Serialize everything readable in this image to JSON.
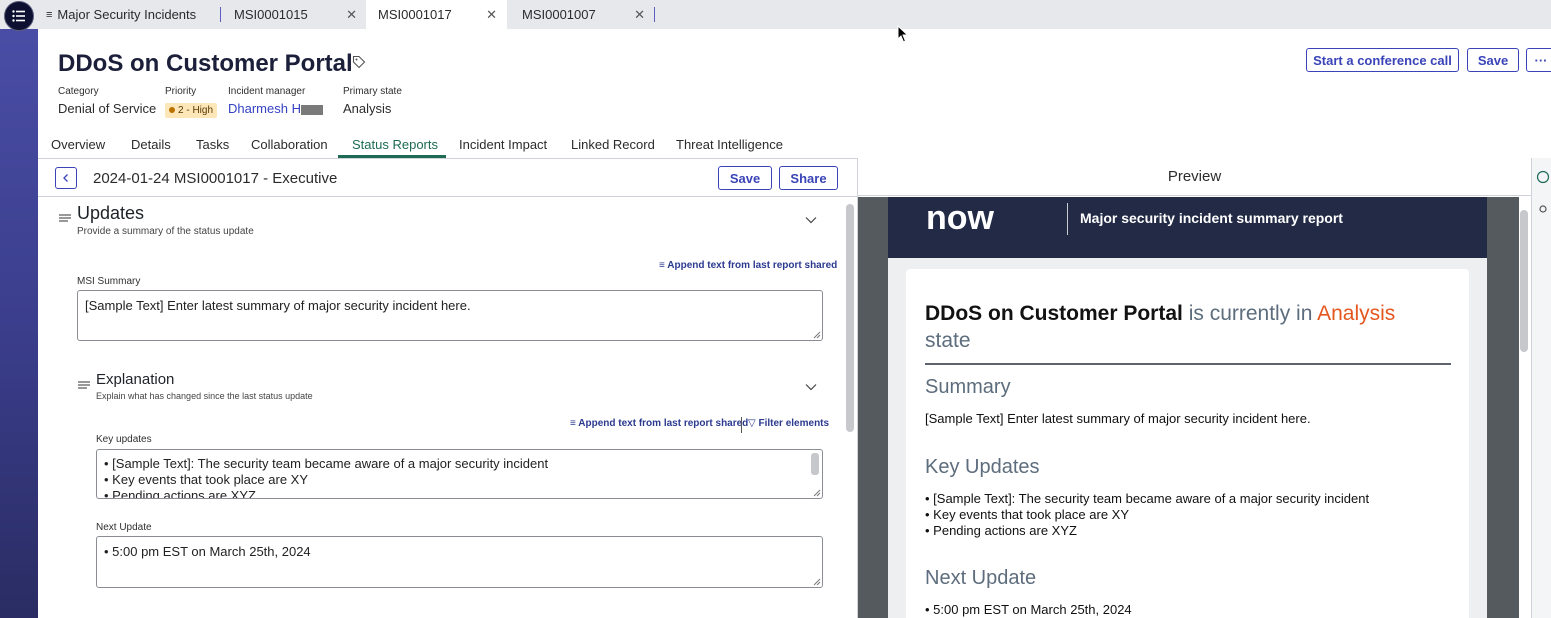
{
  "tabs": [
    {
      "label": "Major Security Incidents"
    },
    {
      "label": "MSI0001015"
    },
    {
      "label": "MSI0001017"
    },
    {
      "label": "MSI0001007"
    }
  ],
  "header": {
    "title": "DDoS on Customer Portal",
    "category_label": "Category",
    "category_value": "Denial of Service",
    "priority_label": "Priority",
    "priority_value": "2 - High",
    "manager_label": "Incident manager",
    "manager_value": "Dharmesh H",
    "state_label": "Primary state",
    "state_value": "Analysis",
    "conference_btn": "Start a conference call",
    "save_btn": "Save",
    "more_btn": "···"
  },
  "main_tabs": [
    "Overview",
    "Details",
    "Tasks",
    "Collaboration",
    "Status Reports",
    "Incident Impact",
    "Linked Record",
    "Threat Intelligence"
  ],
  "editor": {
    "report_title": "2024-01-24 MSI0001017 - Executive",
    "save_btn": "Save",
    "share_btn": "Share",
    "updates": {
      "title": "Updates",
      "subtitle": "Provide a summary of the status update",
      "append_link": "Append text from last report shared",
      "summary_label": "MSI Summary",
      "summary_value": "[Sample Text] Enter latest summary of major security incident here."
    },
    "explanation": {
      "title": "Explanation",
      "subtitle": "Explain what has changed since the last status update",
      "append_link": "Append text from last report shared",
      "filter_link": "Filter elements",
      "key_updates_label": "Key updates",
      "key_updates": [
        "• [Sample Text]: The security team became aware of a major security incident",
        "• Key events that took place are XY",
        "• Pending actions are XYZ"
      ],
      "next_update_label": "Next Update",
      "next_update_value": "• 5:00 pm EST on March 25th, 2024"
    }
  },
  "preview": {
    "title": "Preview",
    "logo_text": "now",
    "banner_title": "Major security incident summary report",
    "headline_name": "DDoS on Customer Portal",
    "headline_mid": " is currently in ",
    "headline_state": "Analysis",
    "headline_end": "state",
    "summary_heading": "Summary",
    "summary_text": "[Sample Text] Enter latest summary of major security incident here.",
    "key_updates_heading": "Key Updates",
    "key_updates": [
      "• [Sample Text]: The security team became aware of a major security incident",
      "• Key events that took place are XY",
      "• Pending actions are XYZ"
    ],
    "next_update_heading": "Next Update",
    "next_update_text": "• 5:00 pm EST on March 25th, 2024"
  },
  "colors": {
    "accent": "#3a44b8",
    "active_tab": "#1d6b54",
    "state_orange": "#e4571f",
    "banner": "#222a45"
  }
}
